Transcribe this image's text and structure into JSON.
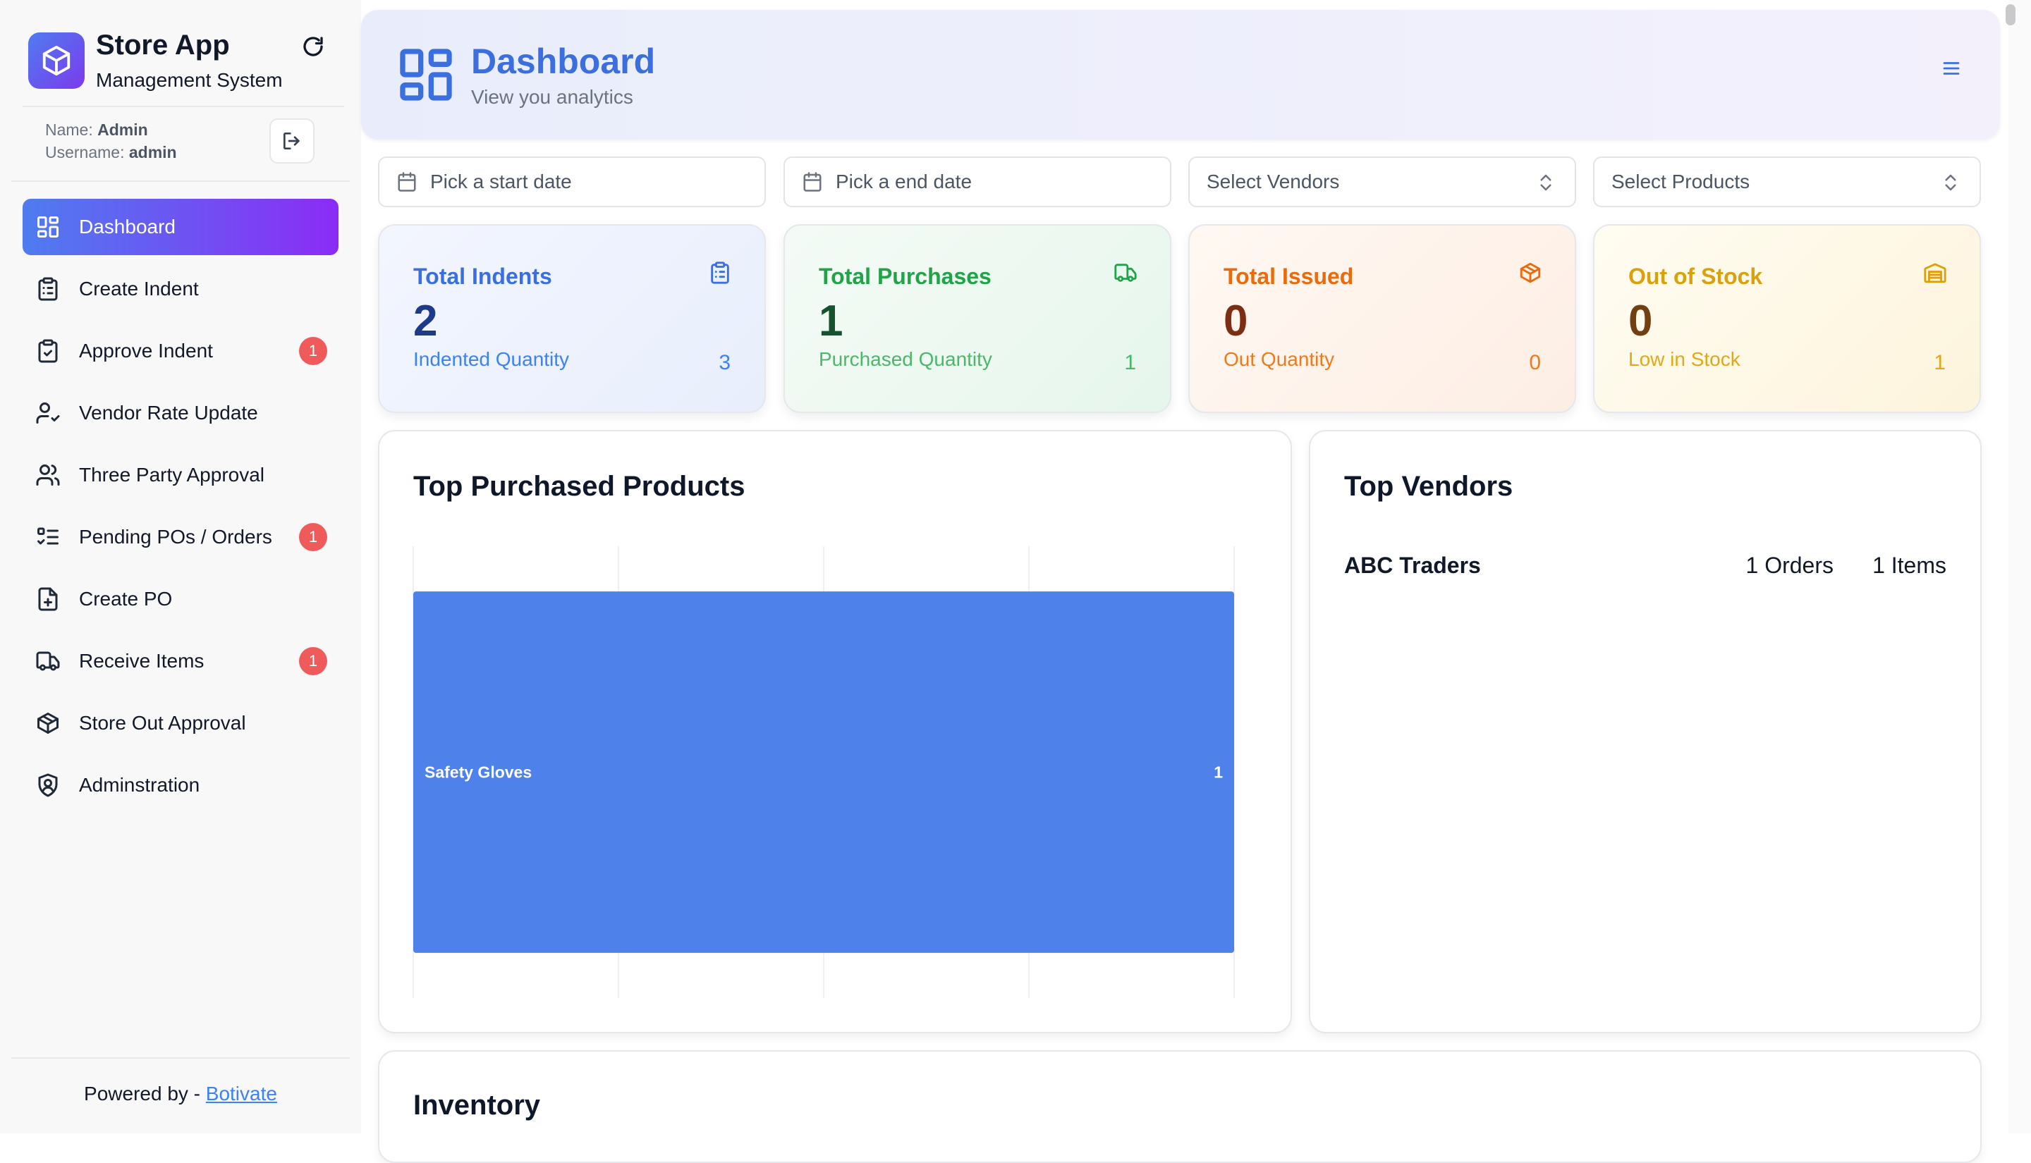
{
  "app": {
    "name": "Store App",
    "subtitle": "Management System"
  },
  "user": {
    "name_label": "Name:",
    "name": "Admin",
    "username_label": "Username:",
    "username": "admin"
  },
  "sidebar": {
    "items": [
      {
        "label": "Dashboard",
        "icon": "layout-dashboard-icon",
        "active": true,
        "badge": ""
      },
      {
        "label": "Create Indent",
        "icon": "clipboard-list-icon",
        "active": false,
        "badge": ""
      },
      {
        "label": "Approve Indent",
        "icon": "clipboard-check-icon",
        "active": false,
        "badge": "1"
      },
      {
        "label": "Vendor Rate Update",
        "icon": "user-check-icon",
        "active": false,
        "badge": ""
      },
      {
        "label": "Three Party Approval",
        "icon": "users-icon",
        "active": false,
        "badge": ""
      },
      {
        "label": "Pending POs / Orders",
        "icon": "list-todo-icon",
        "active": false,
        "badge": "1"
      },
      {
        "label": "Create PO",
        "icon": "file-plus-icon",
        "active": false,
        "badge": ""
      },
      {
        "label": "Receive Items",
        "icon": "truck-icon",
        "active": false,
        "badge": "1"
      },
      {
        "label": "Store Out Approval",
        "icon": "package-check-icon",
        "active": false,
        "badge": ""
      },
      {
        "label": "Adminstration",
        "icon": "shield-user-icon",
        "active": false,
        "badge": ""
      }
    ]
  },
  "footer": {
    "prefix": "Powered by - ",
    "link": "Botivate"
  },
  "header": {
    "title": "Dashboard",
    "subtitle": "View you analytics"
  },
  "filters": {
    "start_date_placeholder": "Pick a start date",
    "end_date_placeholder": "Pick a end date",
    "vendors_placeholder": "Select Vendors",
    "products_placeholder": "Select Products"
  },
  "stats": [
    {
      "title": "Total Indents",
      "value": "2",
      "label": "Indented Quantity",
      "count": "3",
      "icon": "clipboard-list-icon",
      "title_color": "#3b6fe0",
      "value_color": "#1e3a8a",
      "label_color": "#3b82f6"
    },
    {
      "title": "Total Purchases",
      "value": "1",
      "label": "Purchased Quantity",
      "count": "1",
      "icon": "truck-icon",
      "title_color": "#22a34a",
      "value_color": "#14532d",
      "label_color": "#4ab86a"
    },
    {
      "title": "Total Issued",
      "value": "0",
      "label": "Out Quantity",
      "count": "0",
      "icon": "package-icon",
      "title_color": "#ea6a0c",
      "value_color": "#7c2d12",
      "label_color": "#f07a1a"
    },
    {
      "title": "Out of Stock",
      "value": "0",
      "label": "Low in Stock",
      "count": "1",
      "icon": "warehouse-icon",
      "title_color": "#d9a10b",
      "value_color": "#713f12",
      "label_color": "#e0a915"
    }
  ],
  "top_products": {
    "title": "Top Purchased Products"
  },
  "chart_data": {
    "type": "bar",
    "orientation": "horizontal",
    "categories": [
      "Safety Gloves"
    ],
    "values": [
      1
    ],
    "xlim": [
      0,
      1
    ],
    "grid": true,
    "bar_color": "#4f81eb"
  },
  "top_vendors": {
    "title": "Top Vendors",
    "rows": [
      {
        "name": "ABC Traders",
        "orders": "1 Orders",
        "items": "1 Items"
      }
    ]
  },
  "inventory": {
    "title": "Inventory"
  }
}
